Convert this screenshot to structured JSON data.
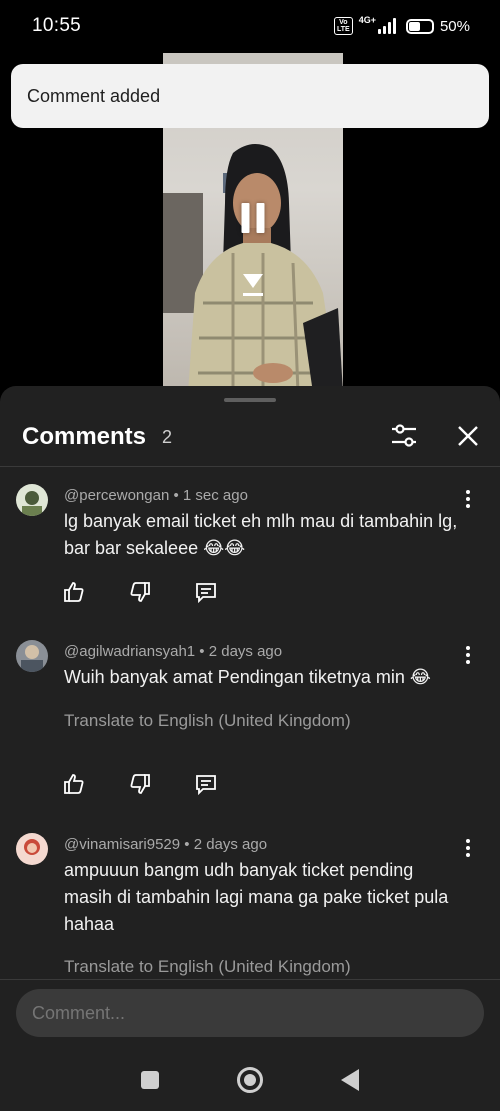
{
  "status_bar": {
    "time": "10:55",
    "volte": "Vo LTE",
    "network": "4G+",
    "battery": "50%",
    "battery_level": 0.5
  },
  "toast": {
    "message": "Comment added"
  },
  "video": {
    "state": "playing"
  },
  "comments_panel": {
    "title": "Comments",
    "count": "2",
    "comments": [
      {
        "meta": "@percewongan • 1 sec ago",
        "text": "lg banyak email ticket eh mlh mau di tambahin lg, bar bar sekaleee 😂😂"
      },
      {
        "meta": "@agilwadriansyah1 • 2 days ago",
        "text": "Wuih banyak amat Pendingan tiketnya min 😂",
        "translate": "Translate to English (United Kingdom)"
      },
      {
        "meta": "@vinamisari9529 • 2 days ago",
        "text": "ampuuun bangm udh banyak ticket pending masih di tambahin lagi mana ga pake ticket pula hahaa",
        "translate": "Translate to English (United Kingdom)"
      }
    ],
    "input_placeholder": "Comment..."
  },
  "colors": {
    "panel_bg": "#212121",
    "toast_bg": "#f2f2f2",
    "secondary_text": "#aaaaaa"
  }
}
